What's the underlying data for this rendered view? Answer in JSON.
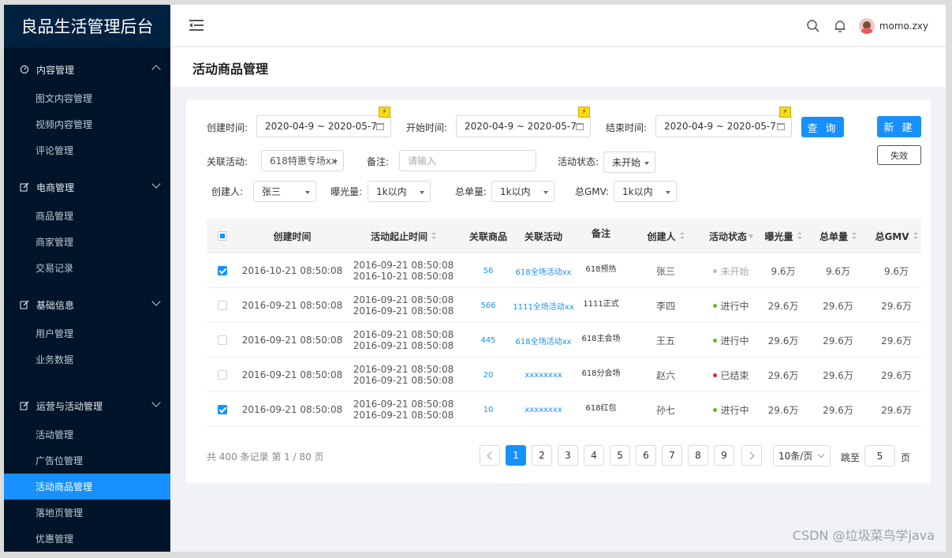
{
  "app": {
    "title": "良品生活管理后台"
  },
  "sidebar": {
    "groups": [
      {
        "label": "内容管理",
        "icon": "dashboard-icon",
        "expanded": true,
        "items": [
          "图文内容管理",
          "视频内容管理",
          "评论管理"
        ]
      },
      {
        "label": "电商管理",
        "icon": "edit-icon",
        "expanded": false,
        "items": [
          "商品管理",
          "商家管理",
          "交易记录"
        ]
      },
      {
        "label": "基础信息",
        "icon": "edit-icon",
        "expanded": false,
        "items": [
          "用户管理",
          "业务数据"
        ]
      },
      {
        "label": "运营与活动管理",
        "icon": "edit-icon",
        "expanded": false,
        "items": [
          "活动管理",
          "广告位管理",
          "活动商品管理",
          "落地页管理",
          "优惠管理"
        ]
      }
    ],
    "active_item": "活动商品管理"
  },
  "header": {
    "username": "momo.zxy",
    "icons": [
      "menu-fold-icon",
      "search-icon",
      "bell-icon",
      "avatar"
    ]
  },
  "page": {
    "title": "活动商品管理"
  },
  "filters": {
    "created_label": "创建时间:",
    "created_value": "2020-04-9 ~ 2020-05-7",
    "start_label": "开始时间:",
    "start_value": "2020-04-9 ~ 2020-05-7",
    "end_label": "结束时间:",
    "end_value": "2020-04-9 ~ 2020-05-7",
    "activity_label": "关联活动:",
    "activity_value": "618特惠专场xx",
    "remark_label": "备注:",
    "remark_placeholder": "请输入",
    "status_label": "活动状态:",
    "status_value": "未开始",
    "creator_label": "创建人:",
    "creator_value": "张三",
    "exposure_label": "曝光量:",
    "exposure_value": "1k以内",
    "orders_label": "总单量:",
    "orders_value": "1k以内",
    "gmv_label": "总GMV:",
    "gmv_value": "1k以内",
    "bolt_glyph": "⚡"
  },
  "buttons": {
    "query": "查 询",
    "create": "新 建",
    "invalidate": "失效"
  },
  "table": {
    "columns": [
      "创建时间",
      "活动起止时间",
      "关联商品",
      "关联活动",
      "备注",
      "创建人",
      "活动状态",
      "曝光量",
      "总单量",
      "总GMV"
    ],
    "rows": [
      {
        "checked": true,
        "created": "2016-10-21  08:50:08",
        "start": "2016-09-21  08:50:08",
        "end": "2016-10-21  08:50:08",
        "goods": "56",
        "activity": "618全场活动xx",
        "remark": "618预热",
        "creator": "张三",
        "status": "未开始",
        "status_color": "#bfbfbf",
        "exposure": "9.6万",
        "orders": "9.6万",
        "gmv": "9.6万"
      },
      {
        "checked": false,
        "created": "2016-09-21  08:50:08",
        "start": "2016-09-21  08:50:08",
        "end": "2016-09-21  08:50:08",
        "goods": "566",
        "activity": "1111全场活动xx",
        "remark": "1111正式",
        "creator": "李四",
        "status": "进行中",
        "status_color": "#52c41a",
        "exposure": "29.6万",
        "orders": "29.6万",
        "gmv": "29.6万"
      },
      {
        "checked": false,
        "created": "2016-09-21  08:50:08",
        "start": "2016-09-21  08:50:08",
        "end": "2016-09-21  08:50:08",
        "goods": "445",
        "activity": "618全场活动xx",
        "remark": "618主会场",
        "creator": "王五",
        "status": "进行中",
        "status_color": "#52c41a",
        "exposure": "29.6万",
        "orders": "29.6万",
        "gmv": "29.6万"
      },
      {
        "checked": false,
        "created": "2016-09-21  08:50:08",
        "start": "2016-09-21  08:50:08",
        "end": "2016-09-21  08:50:08",
        "goods": "20",
        "activity": "xxxxxxxx",
        "remark": "618分会场",
        "creator": "赵六",
        "status": "已结束",
        "status_color": "#f5222d",
        "exposure": "29.6万",
        "orders": "29.6万",
        "gmv": "29.6万"
      },
      {
        "checked": true,
        "created": "2016-09-21  08:50:08",
        "start": "2016-09-21  08:50:08",
        "end": "2016-09-21  08:50:08",
        "goods": "10",
        "activity": "xxxxxxxx",
        "remark": "618红包",
        "creator": "孙七",
        "status": "进行中",
        "status_color": "#52c41a",
        "exposure": "29.6万",
        "orders": "29.6万",
        "gmv": "29.6万"
      }
    ]
  },
  "pagination": {
    "summary": "共 400 条记录 第 1 / 80 页",
    "pages": [
      "1",
      "2",
      "3",
      "4",
      "5",
      "6",
      "7",
      "8",
      "9"
    ],
    "current": "1",
    "page_size": "10条/页",
    "jump_label": "跳至",
    "jump_value": "5",
    "page_unit": "页"
  },
  "watermark": "CSDN @垃圾菜鸟学java",
  "colors": {
    "accent": "#1890ff",
    "sidebar_bg": "#001529",
    "brand_bg": "#002140"
  }
}
